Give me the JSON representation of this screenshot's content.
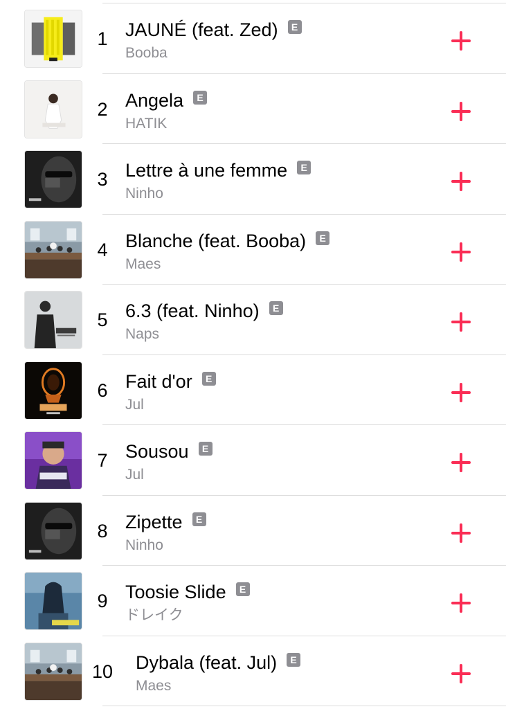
{
  "explicit_badge": "E",
  "accent_color": "#fa2d55",
  "songs": [
    {
      "rank": "1",
      "title": "JAUNÉ (feat. Zed)",
      "artist": "Booba",
      "explicit": true,
      "art": "yellow-jaune-cover"
    },
    {
      "rank": "2",
      "title": "Angela",
      "artist": "HATIK",
      "explicit": true,
      "art": "white-portrait-cover"
    },
    {
      "rank": "3",
      "title": "Lettre à une femme",
      "artist": "Ninho",
      "explicit": true,
      "art": "mils-cover"
    },
    {
      "rank": "4",
      "title": "Blanche (feat. Booba)",
      "artist": "Maes",
      "explicit": true,
      "art": "last-supper-cover"
    },
    {
      "rank": "5",
      "title": "6.3 (feat. Ninho)",
      "artist": "Naps",
      "explicit": true,
      "art": "naps-cover"
    },
    {
      "rank": "6",
      "title": "Fait d'or",
      "artist": "Jul",
      "explicit": true,
      "art": "jul-fait-dor-cover"
    },
    {
      "rank": "7",
      "title": "Sousou",
      "artist": "Jul",
      "explicit": true,
      "art": "jul-sousou-cover"
    },
    {
      "rank": "8",
      "title": "Zipette",
      "artist": "Ninho",
      "explicit": true,
      "art": "mils-cover"
    },
    {
      "rank": "9",
      "title": "Toosie Slide",
      "artist": "ドレイク",
      "explicit": true,
      "art": "toosie-slide-cover"
    },
    {
      "rank": "10",
      "title": "Dybala (feat. Jul)",
      "artist": "Maes",
      "explicit": true,
      "art": "last-supper-cover"
    }
  ]
}
